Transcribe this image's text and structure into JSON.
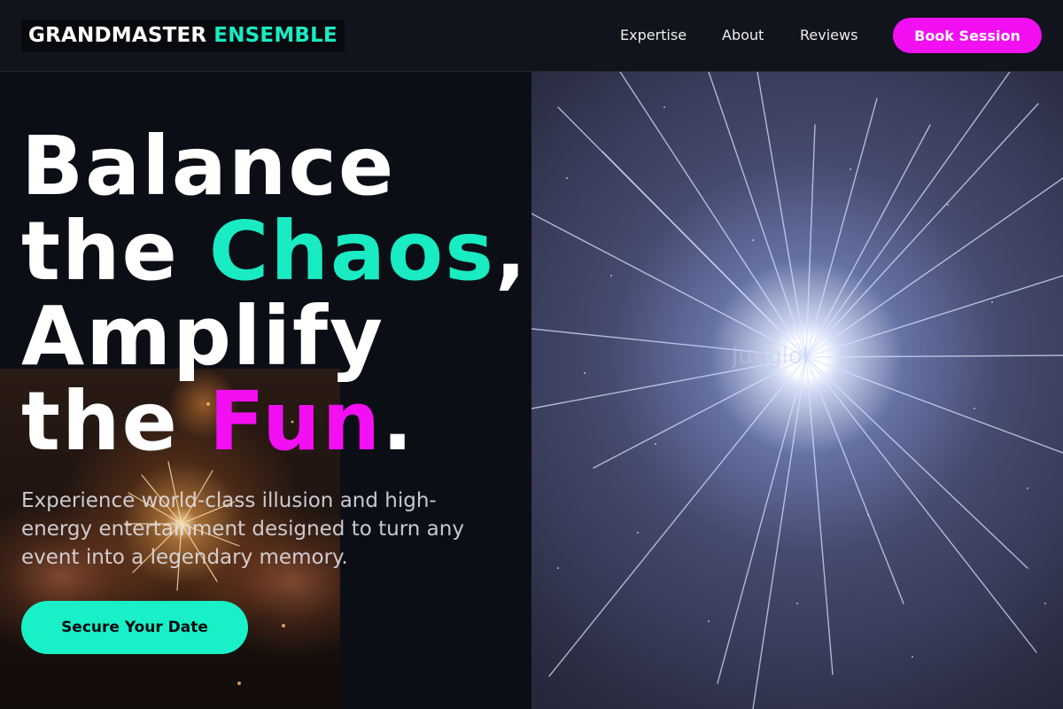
{
  "header": {
    "logo_part1": "GRANDMASTER",
    "logo_part2": "ENSEMBLE",
    "nav": [
      {
        "label": "Expertise"
      },
      {
        "label": "About"
      },
      {
        "label": "Reviews"
      }
    ],
    "book_button": "Book Session"
  },
  "hero": {
    "headline": {
      "line1": "Balance",
      "line2_word1": "the",
      "line2_accent": "Chaos",
      "line2_punct": ",",
      "line3": "Amplify",
      "line4_word1": "the",
      "line4_accent": "Fun",
      "line4_punct": "."
    },
    "subtext": "Experience world-class illusion and high-energy entertainment designed to turn any event into a legendary memory.",
    "cta_label": "Secure Your Date",
    "image_watermark": "jugglol"
  },
  "colors": {
    "teal_accent": "#19ebc2",
    "magenta_accent": "#f20ff2",
    "background": "#0c0e15"
  }
}
